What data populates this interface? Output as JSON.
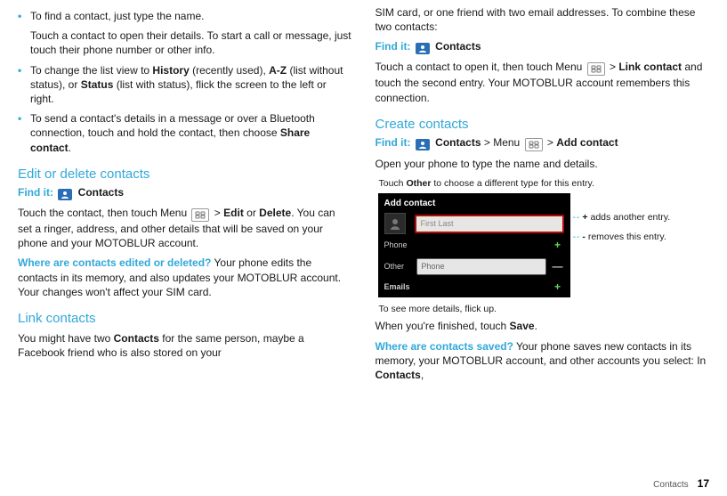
{
  "left": {
    "b1_a": "To find a contact, just type the name.",
    "b1_b": "Touch a contact to open their details. To start a call or message, just touch their phone number or other info.",
    "b2_pre": "To change the list view to ",
    "b2_hist": "History",
    "b2_hist_note": " (recently used), ",
    "b2_az": "A-Z",
    "b2_az_note": " (list without status), or ",
    "b2_status": "Status",
    "b2_status_note": " (list with status), flick the screen to the left or right.",
    "b3_pre": "To send a contact's details in a message or over a Bluetooth connection, touch and hold the contact, then choose ",
    "b3_bold": "Share contact",
    "b3_post": ".",
    "h_edit": "Edit or delete contacts",
    "find_label": "Find it:",
    "contacts": "Contacts",
    "edit_p1_a": "Touch the contact, then touch Menu ",
    "edit_p1_b": " > ",
    "edit_bold": "Edit",
    "edit_or": " or ",
    "delete_bold": "Delete",
    "edit_p1_c": ". You can set a ringer, address, and other details that will be saved on your phone and your MOTOBLUR account.",
    "where_q": "Where are contacts edited or deleted?",
    "where_a": " Your phone edits the contacts in its memory, and also updates your MOTOBLUR account. Your changes won't affect your SIM card.",
    "h_link": "Link contacts",
    "link_p_a": "You might have two ",
    "link_bold": "Contacts",
    "link_p_b": " for the same person, maybe a Facebook friend who is also stored on your"
  },
  "right": {
    "cont_top": "SIM card, or one friend with two email addresses. To combine these two contacts:",
    "link_p_a": "Touch a contact to open it, then touch Menu ",
    "link_p_b": " > ",
    "link_bold": "Link contact",
    "link_p_c": " and touch the second entry. Your MOTOBLUR account remembers this connection.",
    "h_create": "Create contacts",
    "create_find_mid": " > Menu ",
    "create_find_end": " > ",
    "add_contact": "Add contact",
    "open_phone": "Open your phone to type the name and details.",
    "callout_top_a": "Touch ",
    "callout_top_bold": "Other",
    "callout_top_b": " to choose a different type for this entry.",
    "phone_title": "Add contact",
    "name_placeholder": "First Last",
    "label_phone": "Phone",
    "label_other": "Other",
    "other_placeholder": "Phone",
    "label_emails": "Emails",
    "sc_add_a": "+",
    "sc_add_b": " adds another entry.",
    "sc_rem_a": "-",
    "sc_rem_b": " removes this entry.",
    "callout_bottom": "To see more details, flick up.",
    "after_a": "When you're finished, touch ",
    "save": "Save",
    "after_b": ".",
    "where_q": "Where are contacts saved?",
    "where_a": " Your phone saves new contacts in its memory, your MOTOBLUR account, and other accounts you select: In ",
    "where_bold": "Contacts",
    "where_c": ","
  },
  "footer": {
    "section": "Contacts",
    "page": "17"
  }
}
